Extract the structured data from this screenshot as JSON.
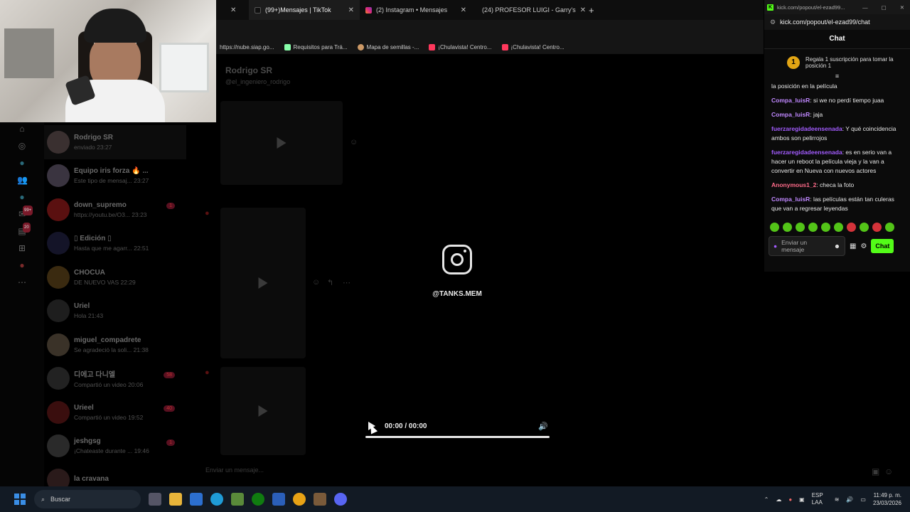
{
  "browser": {
    "tabs": [
      {
        "label": "",
        "active": false
      },
      {
        "label": "(99+)Mensajes | TikTok",
        "active": true
      },
      {
        "label": "(2) Instagram • Mensajes",
        "active": false
      },
      {
        "label": "(24) PROFESOR LUIGI - Garry's",
        "active": false
      }
    ],
    "bookmarks": [
      "https://nube.siap.go...",
      "Requisitos para Trá...",
      "Mapa de semillas -...",
      "¡Chulavista! Centro...",
      "¡Chulavista! Centro..."
    ]
  },
  "rail": {
    "badges": {
      "b1": "99+",
      "b2": "20"
    }
  },
  "conversations": [
    {
      "name": "Rodrigo SR",
      "sub": "enviado 23:27",
      "badge": "",
      "avatar": "#3a3030"
    },
    {
      "name": "Equipo iris forza 🔥 ...",
      "sub": "Este tipo de mensaj... 23:27",
      "badge": "",
      "avatar": "#3a3440"
    },
    {
      "name": "down_supremo",
      "sub": "https://youtu.be/O3... 23:23",
      "badge": "1",
      "avatar": "#5a1010"
    },
    {
      "name": "▯ Edición ▯",
      "sub": "Hasta que me agarr... 22:51",
      "badge": "",
      "avatar": "#141428"
    },
    {
      "name": "CHOCUA",
      "sub": "DE NUEVO VAS 22:29",
      "badge": "",
      "avatar": "#3a2a10"
    },
    {
      "name": "Uriel",
      "sub": "Hola 21:43",
      "badge": "",
      "avatar": "#1e1e1e"
    },
    {
      "name": "miguel_compadrete",
      "sub": "Se agradeció la soli... 21:38",
      "badge": "",
      "avatar": "#3a3228"
    },
    {
      "name": "디에고 다니엘",
      "sub": "Compartió un video 20:06",
      "badge": "58",
      "avatar": "#222"
    },
    {
      "name": "Urieel",
      "sub": "Compartió un video 19:52",
      "badge": "40",
      "avatar": "#3a0e0e"
    },
    {
      "name": "jeshgsg",
      "sub": "¡Chateaste durante ... 19:46",
      "badge": "1",
      "avatar": "#2a2a2a"
    },
    {
      "name": "la cravana",
      "sub": "",
      "badge": "",
      "avatar": "#2a1a1a"
    }
  ],
  "chat": {
    "title": "Rodrigo SR",
    "username": "@el_ingeniero_rodrigo",
    "composer_placeholder": "Enviar un mensaje..."
  },
  "overlay": {
    "ig_username": "@TANKS.MEM",
    "time": "00:00 / 00:00",
    "progress": 1.0
  },
  "kick": {
    "url": "kick.com/popout/el-ezad99/chat",
    "tab_url": "kick.com/popout/el-ezad99...",
    "title": "Chat",
    "sub_num": "1",
    "sub_text": "Regala 1 suscripción para tomar la posición 1",
    "messages": [
      {
        "user": "",
        "text": "la posición en la película",
        "color": "#e8e8e8"
      },
      {
        "user": "Compa_luisR",
        "text": ": si we no perdí tiempo juaa",
        "color": "#c088ff"
      },
      {
        "user": "Compa_luisR",
        "text": ": jaja",
        "color": "#c088ff"
      },
      {
        "user": "fuerzaregidadeensenada",
        "text": ": Y qué coincidencia ambos son pelirrojos",
        "color": "#a35cff"
      },
      {
        "user": "fuerzaregidadeensenada",
        "text": ": es en serio van a hacer un reboot la película vieja y la van a convertir en Nueva con nuevos actores",
        "color": "#a35cff"
      },
      {
        "user": "Anonymous1_2",
        "text": ": checa la foto",
        "color": "#ff6b8a"
      },
      {
        "user": "Compa_luisR",
        "text": ": las películas están tan culeras que van a regresar leyendas",
        "color": "#c088ff"
      }
    ],
    "input_placeholder": "Enviar un mensaje",
    "chat_button": "Chat"
  },
  "taskbar": {
    "search": "Buscar",
    "lang": "ESP LAA",
    "time": "11:49 p. m.",
    "date": "23/03/2026"
  },
  "colors": {
    "kick_green": "#53fc18",
    "accent_red": "#fe2c55"
  }
}
